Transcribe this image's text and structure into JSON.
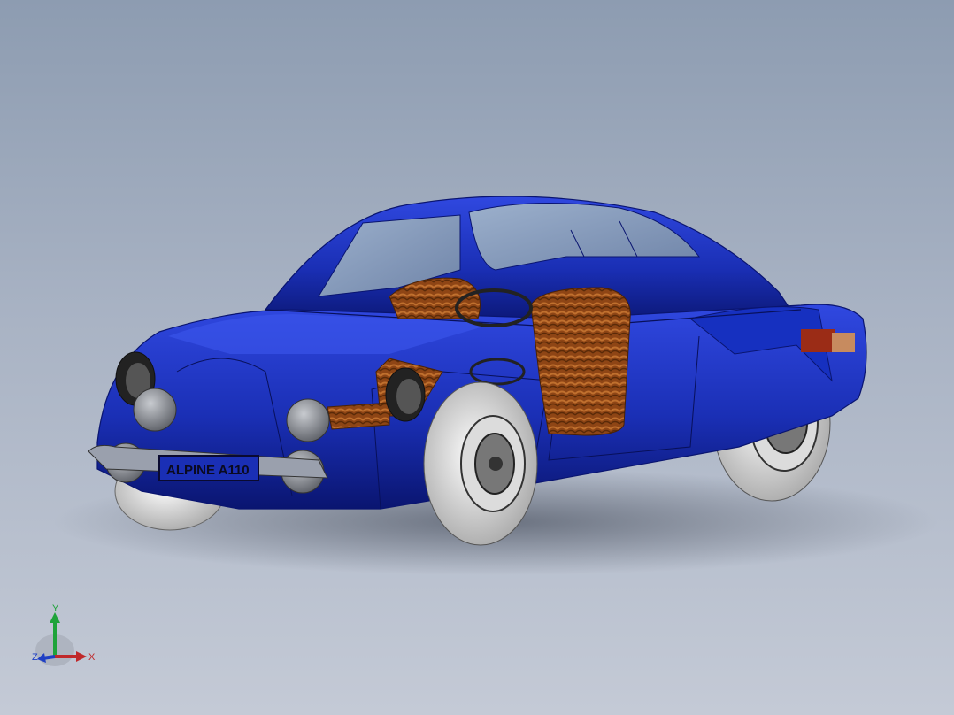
{
  "model": {
    "plate_text": "ALPINE A110"
  },
  "triad": {
    "x_label": "X",
    "y_label": "Y",
    "z_label": "Z"
  },
  "colors": {
    "body": "#1a2fb5",
    "body_dark": "#0a1570",
    "glass": "#7f93b3",
    "seat": "#9a4e1c",
    "tire": "#c9c9c9",
    "lamp": "#8a8d92",
    "axis_x": "#c0282a",
    "axis_y": "#1fa33a",
    "axis_z": "#1f3fc4"
  }
}
